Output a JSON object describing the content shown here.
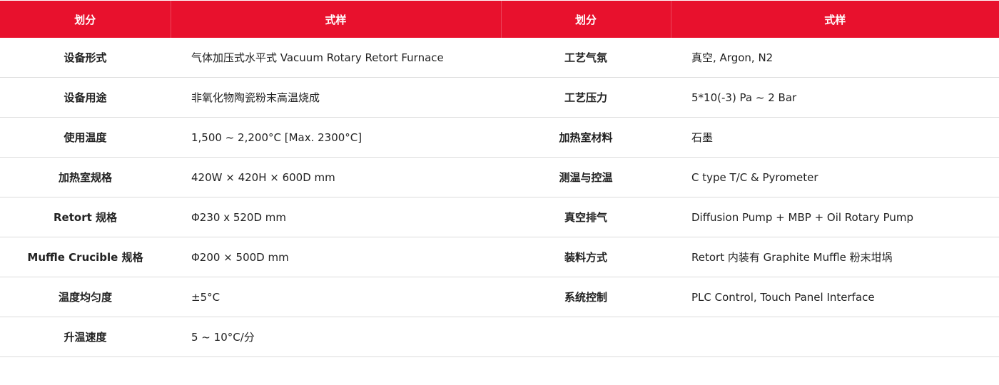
{
  "header": {
    "col1": "划分",
    "col2": "式样",
    "col3": "划分",
    "col4": "式样"
  },
  "rows": [
    {
      "label1": "设备形式",
      "value1": "气体加压式水平式 Vacuum Rotary Retort Furnace",
      "label2": "工艺气氛",
      "value2": "真空, Argon, N2"
    },
    {
      "label1": "设备用途",
      "value1": "非氧化物陶瓷粉末高温烧成",
      "label2": "工艺压力",
      "value2": "5*10(-3) Pa ~ 2 Bar"
    },
    {
      "label1": "使用温度",
      "value1": "1,500 ~ 2,200°C [Max. 2300°C]",
      "label2": "加热室材料",
      "value2": "石墨"
    },
    {
      "label1": "加热室规格",
      "value1": "420W × 420H × 600D mm",
      "label2": "测温与控温",
      "value2": "C type T/C & Pyrometer"
    },
    {
      "label1": "Retort 规格",
      "value1": "Φ230 x 520D mm",
      "label2": "真空排气",
      "value2": "Diffusion Pump + MBP + Oil Rotary Pump"
    },
    {
      "label1": "Muffle Crucible 规格",
      "value1": "Φ200 × 500D mm",
      "label2": "装料方式",
      "value2": "Retort 内装有 Graphite Muffle 粉末坩埚"
    },
    {
      "label1": "温度均匀度",
      "value1": "±5°C",
      "label2": "系统控制",
      "value2": "PLC Control, Touch Panel Interface"
    },
    {
      "label1": "升温速度",
      "value1": "5 ~ 10°C/分",
      "label2": "",
      "value2": ""
    }
  ],
  "colors": {
    "header_bg": "#e8112d",
    "header_text": "#ffffff",
    "row_divider": "#dcdcdc"
  }
}
